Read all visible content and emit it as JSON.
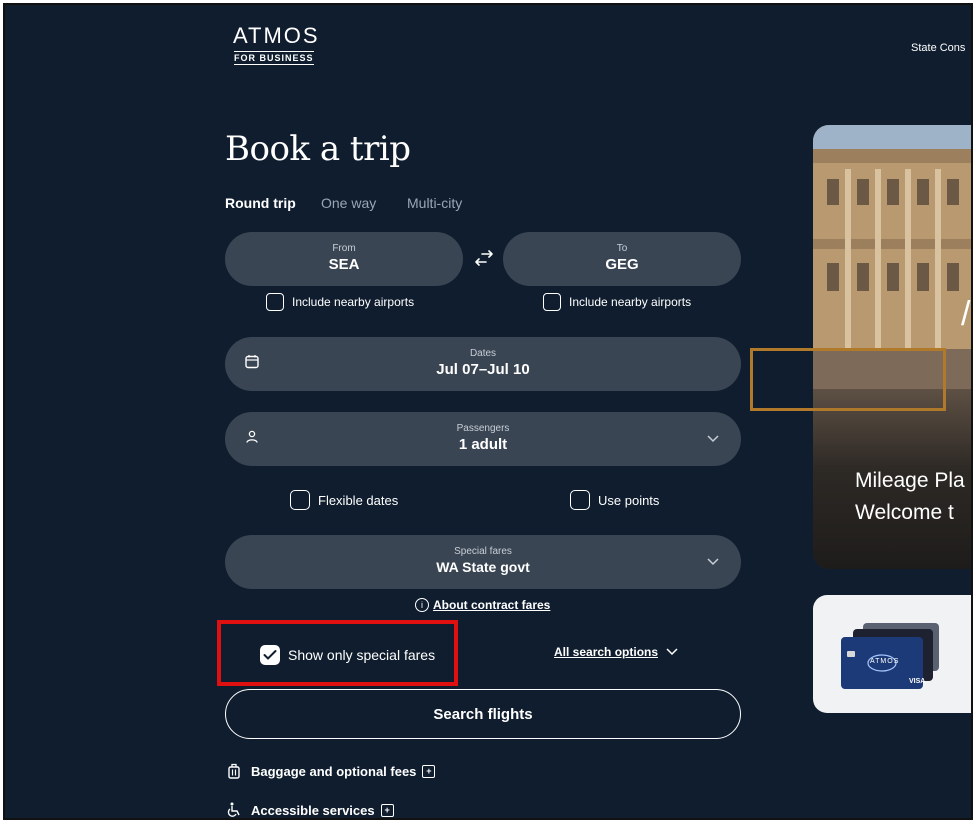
{
  "brand": {
    "name": "ATMOS",
    "sub": "FOR BUSINESS"
  },
  "header": {
    "state_link": "State Cons"
  },
  "booking": {
    "title": "Book a trip",
    "trip_types": [
      "Round trip",
      "One way",
      "Multi-city"
    ],
    "active_trip_type": "Round trip",
    "from": {
      "label": "From",
      "value": "SEA"
    },
    "to": {
      "label": "To",
      "value": "GEG"
    },
    "nearby_from": "Include nearby airports",
    "nearby_to": "Include nearby airports",
    "dates": {
      "label": "Dates",
      "value": "Jul 07–Jul 10"
    },
    "passengers": {
      "label": "Passengers",
      "value": "1 adult"
    },
    "flexible_dates": "Flexible dates",
    "use_points": "Use points",
    "special_fares": {
      "label": "Special fares",
      "value": "WA State govt"
    },
    "about_fares": "About contract fares",
    "show_special": "Show only special fares",
    "show_special_checked": true,
    "all_options": "All search options",
    "search_button": "Search flights",
    "baggage": "Baggage and optional fees",
    "accessible": "Accessible services"
  },
  "promo": {
    "line1": "Mileage Pla",
    "line2": "Welcome t",
    "overlay_letter": "/"
  },
  "card_tile": {
    "card_brand": "ATMOS",
    "network": "VISA"
  },
  "colors": {
    "background": "#0f1d2e",
    "pill": "#3a4553",
    "highlight_red": "#e01010",
    "highlight_orange": "#b07a2a"
  }
}
